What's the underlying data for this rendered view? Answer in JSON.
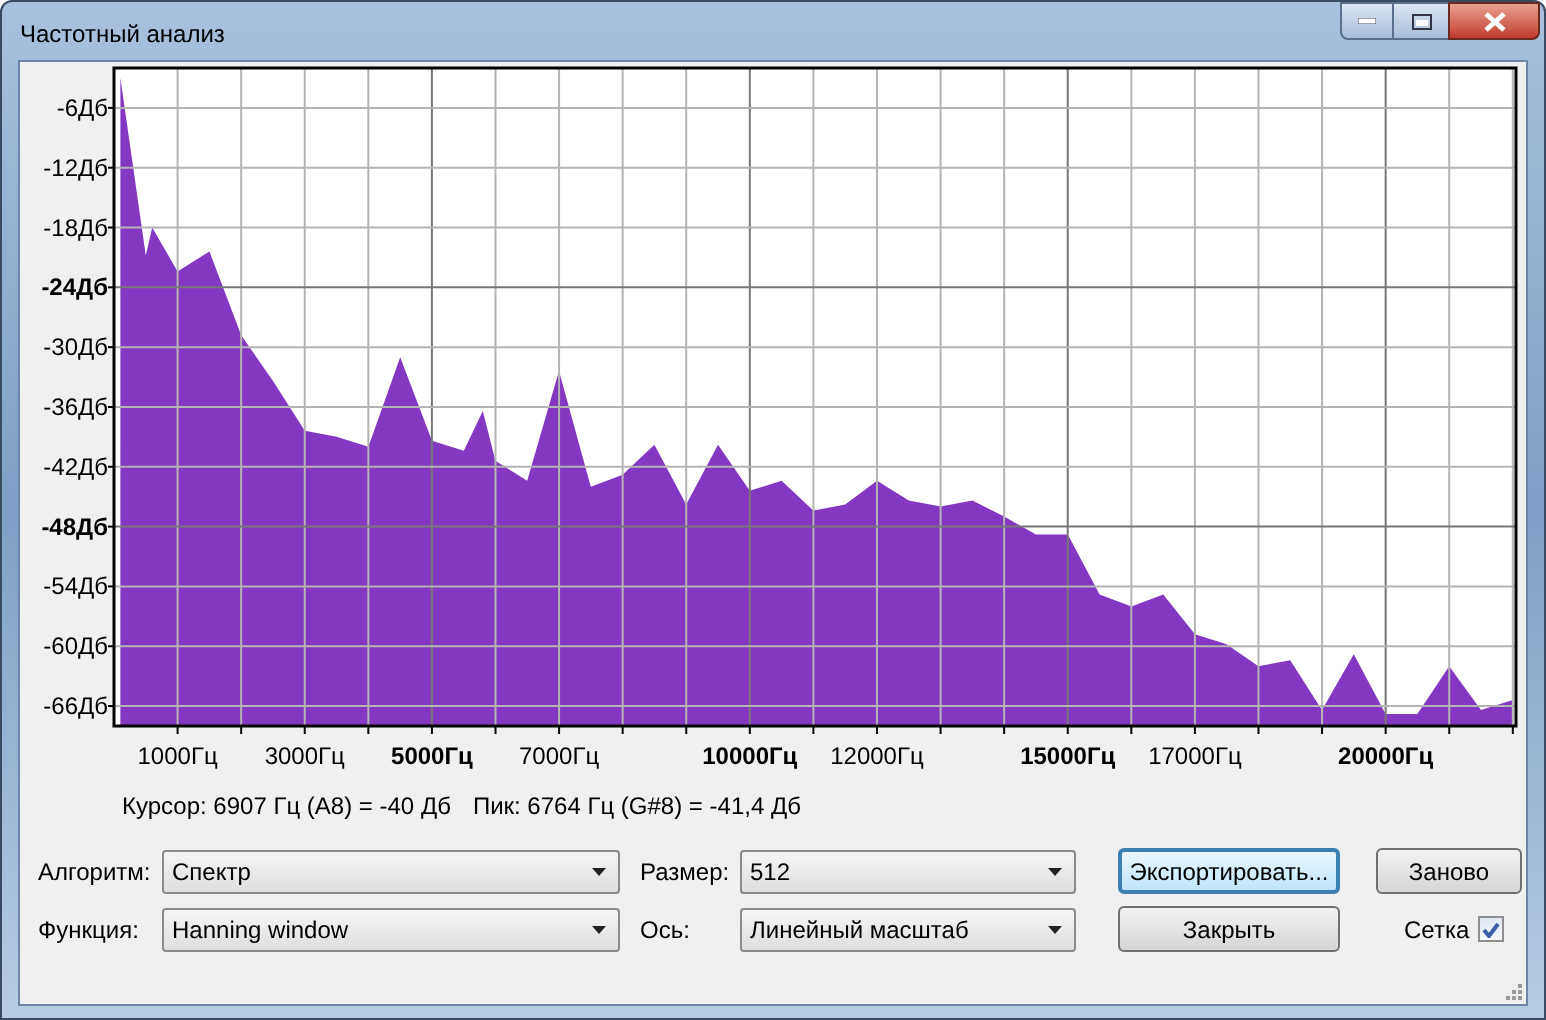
{
  "window": {
    "title": "Частотный анализ"
  },
  "chart": {
    "chart_data": {
      "type": "area",
      "grid": true,
      "xlim": [
        0,
        22050
      ],
      "ylim": [
        -68,
        -2
      ],
      "xticks": [
        {
          "value": 1000,
          "label": "1000Гц"
        },
        {
          "value": 3000,
          "label": "3000Гц"
        },
        {
          "value": 5000,
          "label": "5000Гц"
        },
        {
          "value": 7000,
          "label": "7000Гц"
        },
        {
          "value": 10000,
          "label": "10000Гц"
        },
        {
          "value": 12000,
          "label": "12000Гц"
        },
        {
          "value": 15000,
          "label": "15000Гц"
        },
        {
          "value": 17000,
          "label": "17000Гц"
        },
        {
          "value": 20000,
          "label": "20000Гц"
        }
      ],
      "yticks": [
        {
          "value": -6,
          "label": "-6Дб"
        },
        {
          "value": -12,
          "label": "-12Дб"
        },
        {
          "value": -18,
          "label": "-18Дб"
        },
        {
          "value": -24,
          "label": "-24Дб"
        },
        {
          "value": -30,
          "label": "-30Дб"
        },
        {
          "value": -36,
          "label": "-36Дб"
        },
        {
          "value": -42,
          "label": "-42Дб"
        },
        {
          "value": -48,
          "label": "-48Дб"
        },
        {
          "value": -54,
          "label": "-54Дб"
        },
        {
          "value": -60,
          "label": "-60Дб"
        },
        {
          "value": -66,
          "label": "-66Дб"
        }
      ],
      "x": [
        100,
        500,
        600,
        1000,
        1500,
        2000,
        2500,
        3000,
        3500,
        4000,
        4500,
        5000,
        5500,
        5800,
        6000,
        6500,
        7000,
        7500,
        8000,
        8500,
        9000,
        9500,
        10000,
        10500,
        11000,
        11500,
        12000,
        12500,
        13000,
        13500,
        14000,
        14500,
        15000,
        15500,
        16000,
        16500,
        17000,
        17500,
        18000,
        18500,
        19000,
        19500,
        20000,
        20500,
        21000,
        21500,
        22000
      ],
      "series": [
        {
          "color": "#8437c0",
          "values": [
            -3,
            -20.8,
            -18,
            -22.4,
            -20.4,
            -28.8,
            -33.4,
            -38.4,
            -39,
            -40,
            -31,
            -39.4,
            -40.4,
            -36.4,
            -41.4,
            -43.4,
            -32.4,
            -44,
            -42.8,
            -39.8,
            -45.8,
            -39.8,
            -44.4,
            -43.4,
            -46.4,
            -45.8,
            -43.4,
            -45.4,
            -46,
            -45.4,
            -47,
            -48.8,
            -48.8,
            -54.8,
            -56,
            -54.8,
            -58.8,
            -59.8,
            -62,
            -61.4,
            -66.4,
            -60.8,
            -66.8,
            -66.8,
            -62,
            -66.4,
            -65.4
          ]
        }
      ]
    }
  },
  "readout": {
    "cursor": "Курсор: 6907 Гц (A8) = -40 Дб",
    "peak": "Пик: 6764 Гц (G#8) = -41,4 Дб"
  },
  "fields": [
    {
      "label": "Алгоритм:",
      "value": "Спектр"
    },
    {
      "label": "Размер:",
      "value": "512"
    },
    {
      "label": "Функция:",
      "value": "Hanning window"
    },
    {
      "label": "Ось:",
      "value": "Линейный масштаб"
    }
  ],
  "buttons": [
    {
      "label": "Экспортировать...",
      "focused": true
    },
    {
      "label": "Заново",
      "focused": false
    },
    {
      "label": "Закрыть",
      "focused": false
    }
  ],
  "grid_checkbox": {
    "label": "Сетка",
    "checked": true
  }
}
